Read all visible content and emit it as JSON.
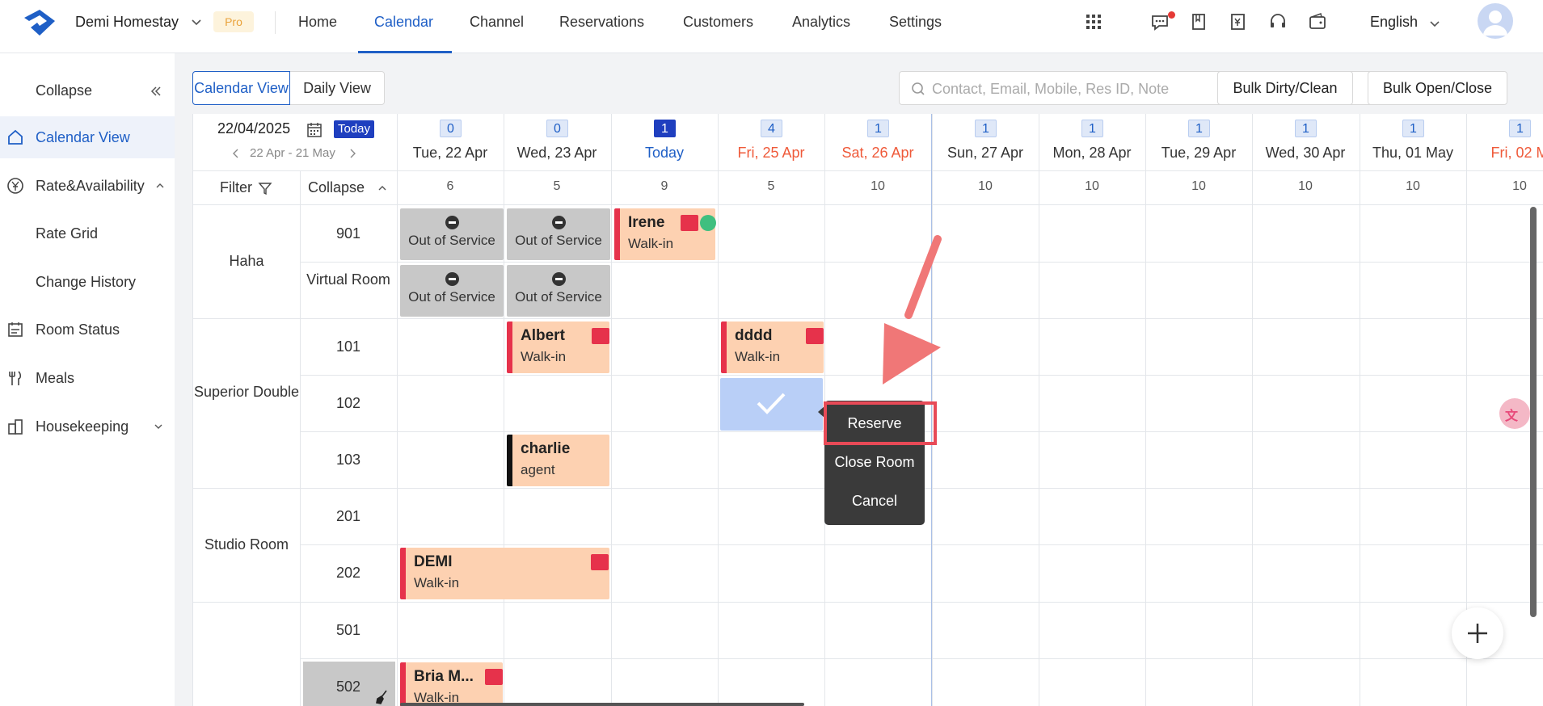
{
  "topbar": {
    "brand": "Demi Homestay",
    "pro": "Pro",
    "nav": [
      "Home",
      "Calendar",
      "Channel",
      "Reservations",
      "Customers",
      "Analytics",
      "Settings"
    ],
    "active_nav": "Calendar",
    "language": "English"
  },
  "sidebar": {
    "collapse": "Collapse",
    "items": [
      "Calendar View",
      "Rate&Availability",
      "Rate Grid",
      "Change History",
      "Room Status",
      "Meals",
      "Housekeeping"
    ]
  },
  "toolbar": {
    "views": [
      "Calendar View",
      "Daily View"
    ],
    "search_placeholder": "Contact, Email, Mobile, Res ID, Note",
    "bulk_dirty": "Bulk Dirty/Clean",
    "bulk_open": "Bulk Open/Close"
  },
  "calendar": {
    "current_date": "22/04/2025",
    "today_btn": "Today",
    "range": "22 Apr - 21 May",
    "filter": "Filter",
    "collapse": "Collapse",
    "columns": [
      {
        "badge": "0",
        "date": "Tue, 22 Apr",
        "count": "6",
        "style": "normal"
      },
      {
        "badge": "0",
        "date": "Wed, 23 Apr",
        "count": "5",
        "style": "normal"
      },
      {
        "badge": "1",
        "date": "Today",
        "count": "9",
        "style": "today"
      },
      {
        "badge": "4",
        "date": "Fri, 25 Apr",
        "count": "5",
        "style": "weekend"
      },
      {
        "badge": "1",
        "date": "Sat, 26 Apr",
        "count": "10",
        "style": "weekend"
      },
      {
        "badge": "1",
        "date": "Sun, 27 Apr",
        "count": "10",
        "style": "normal"
      },
      {
        "badge": "1",
        "date": "Mon, 28 Apr",
        "count": "10",
        "style": "normal"
      },
      {
        "badge": "1",
        "date": "Tue, 29 Apr",
        "count": "10",
        "style": "normal"
      },
      {
        "badge": "1",
        "date": "Wed, 30 Apr",
        "count": "10",
        "style": "normal"
      },
      {
        "badge": "1",
        "date": "Thu, 01 May",
        "count": "10",
        "style": "normal"
      },
      {
        "badge": "1",
        "date": "Fri, 02 M",
        "count": "10",
        "style": "weekend"
      }
    ],
    "room_types": [
      "Haha",
      "Superior Double",
      "Studio Room"
    ],
    "rooms": [
      "901",
      "Virtual Room",
      "101",
      "102",
      "103",
      "201",
      "202",
      "501",
      "502"
    ],
    "out_of_service": "Out of Service",
    "reservations": [
      {
        "name": "Irene",
        "source": "Walk-in"
      },
      {
        "name": "Albert",
        "source": "Walk-in"
      },
      {
        "name": "dddd",
        "source": "Walk-in"
      },
      {
        "name": "charlie",
        "source": "agent"
      },
      {
        "name": "DEMI",
        "source": "Walk-in"
      },
      {
        "name": "Bria M...",
        "source": "Walk-in"
      }
    ]
  },
  "context_menu": {
    "items": [
      "Reserve",
      "Close Room",
      "Cancel"
    ]
  },
  "colors": {
    "accent": "#1f5fc6",
    "reservation_bg": "#fdd1b1",
    "reservation_border": "#e6324b",
    "weekend": "#ef5a3a",
    "out_of_service": "#c8c8c8",
    "menu_bg": "#3a3a3a",
    "highlight": "#e84a57"
  }
}
